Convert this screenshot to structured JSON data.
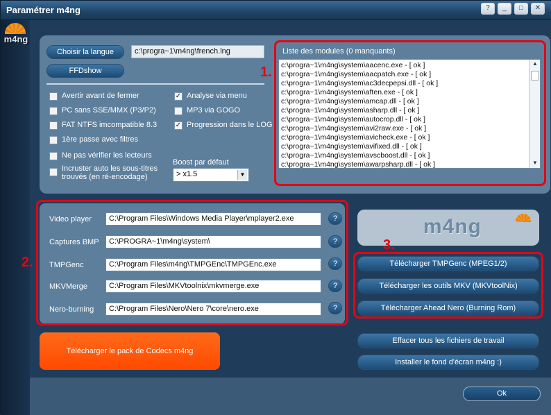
{
  "window": {
    "title": "Paramétrer m4ng",
    "controls": [
      "?",
      "_",
      "□",
      "✕"
    ]
  },
  "logo": {
    "text": "m4ng"
  },
  "language": {
    "choose_label": "Choisir la langue",
    "path": "c:\\progra~1\\m4ng\\french.lng",
    "ffdshow_label": "FFDshow"
  },
  "options_left": [
    {
      "label": "Avertir avant de fermer",
      "checked": false
    },
    {
      "label": "PC sans SSE/MMX (P3/P2)",
      "checked": false
    },
    {
      "label": "FAT NTFS imcompatible 8.3",
      "checked": false
    },
    {
      "label": "1ère passe avec filtres",
      "checked": false
    },
    {
      "label": "Ne pas vérifier les lecteurs",
      "checked": false
    },
    {
      "label": "Incruster auto les sous-titres",
      "label2": "trouvés (en ré-encodage)",
      "checked": false
    }
  ],
  "options_right": [
    {
      "label": "Analyse via menu",
      "checked": true
    },
    {
      "label": "MP3 via GOGO",
      "checked": false
    },
    {
      "label": "Progression dans le LOG",
      "checked": true
    }
  ],
  "boost": {
    "label": "Boost par défaut",
    "value": "> x1.5"
  },
  "modules": {
    "header": "Liste des modules (0 manquants)",
    "items": [
      "c:\\progra~1\\m4ng\\system\\aacenc.exe - [ ok ]",
      "c:\\progra~1\\m4ng\\system\\aacpatch.exe - [ ok ]",
      "c:\\progra~1\\m4ng\\system\\ac3decpepsi.dll - [ ok ]",
      "c:\\progra~1\\m4ng\\system\\aften.exe - [ ok ]",
      "c:\\progra~1\\m4ng\\system\\amcap.dll - [ ok ]",
      "c:\\progra~1\\m4ng\\system\\asharp.dll - [ ok ]",
      "c:\\progra~1\\m4ng\\system\\autocrop.dll - [ ok ]",
      "c:\\progra~1\\m4ng\\system\\avi2raw.exe - [ ok ]",
      "c:\\progra~1\\m4ng\\system\\avicheck.exe - [ ok ]",
      "c:\\progra~1\\m4ng\\system\\avifixed.dll - [ ok ]",
      "c:\\progra~1\\m4ng\\system\\avscboost.dll - [ ok ]",
      "c:\\progra~1\\m4ng\\system\\awarpsharp.dll - [ ok ]"
    ]
  },
  "annotations": {
    "one": "1.",
    "two": "2.",
    "three": "3."
  },
  "paths": [
    {
      "label": "Video player",
      "value": "C:\\Program Files\\Windows Media Player\\mplayer2.exe"
    },
    {
      "label": "Captures BMP",
      "value": "C:\\PROGRA~1\\m4ng\\system\\"
    },
    {
      "label": "TMPGenc",
      "value": "C:\\Program Files\\m4ng\\TMPGEnc\\TMPGEnc.exe"
    },
    {
      "label": "MKVMerge",
      "value": "C:\\Program Files\\MKVtoolnix\\mkvmerge.exe"
    },
    {
      "label": "Nero-burning",
      "value": "C:\\Program Files\\Nero\\Nero 7\\core\\nero.exe"
    }
  ],
  "help_label": "?",
  "downloads": {
    "tmpgenc": "Télécharger TMPGenc (MPEG1/2)",
    "mkv": "Télécharger les outils MKV (MKVtoolNix)",
    "nero": "Télécharger Ahead Nero (Burning Rom)"
  },
  "codec_pack_label": "Télécharger le pack de Codecs m4ng",
  "clear_files_label": "Effacer tous les fichiers de travail",
  "wallpaper_label": "Installer le fond d'écran m4ng :)",
  "ok_label": "Ok",
  "colors": {
    "accent_red": "#e30613",
    "orange": "#ff5500",
    "panel": "#5d7f9c"
  }
}
